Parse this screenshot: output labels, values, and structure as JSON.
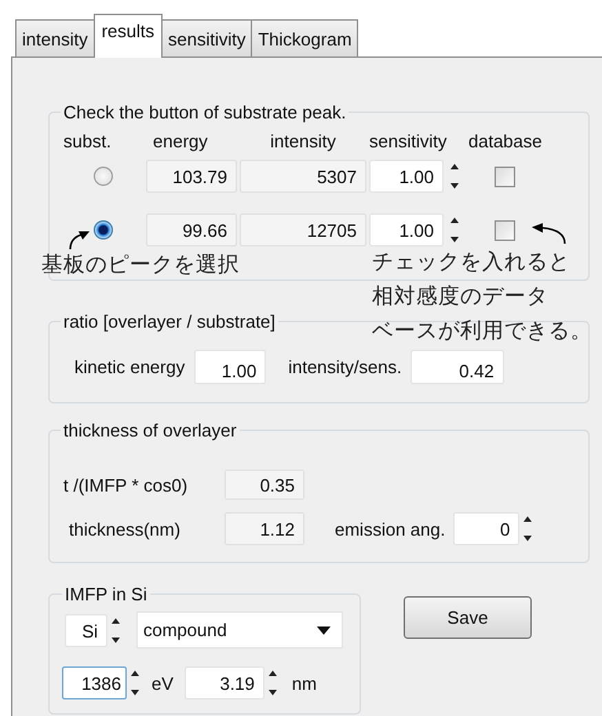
{
  "tabs": [
    {
      "label": "intensity",
      "selected": false
    },
    {
      "label": "results",
      "selected": true
    },
    {
      "label": "sensitivity",
      "selected": false
    },
    {
      "label": "Thickogram",
      "selected": false
    }
  ],
  "peak_group": {
    "legend": "Check the button of substrate peak.",
    "columns": [
      "subst.",
      "energy",
      "intensity",
      "sensitivity",
      "database"
    ],
    "rows": [
      {
        "selected": false,
        "energy": "103.79",
        "intensity": "5307",
        "sensitivity": "1.00",
        "database_checked": false
      },
      {
        "selected": true,
        "energy": "99.66",
        "intensity": "12705",
        "sensitivity": "1.00",
        "database_checked": false
      }
    ]
  },
  "annotations": [
    {
      "lines": [
        "基板のピークを選択"
      ]
    },
    {
      "lines": [
        "チェックを入れると",
        "相対感度のデータ",
        "ベースが利用できる。"
      ]
    }
  ],
  "ratio_group": {
    "legend": "ratio [overlayer / substrate]",
    "kinetic_energy_label": "kinetic energy",
    "kinetic_energy": "1.00",
    "intensity_label": "intensity/sens.",
    "intensity_value": "0.42"
  },
  "thickness_group": {
    "legend": "thickness of overlayer",
    "t_label": "t /(IMFP * cos0)",
    "t_value": "0.35",
    "thickness_label": "thickness(nm)",
    "thickness_value": "1.12",
    "emission_label": "emission ang.",
    "emission_value": "0"
  },
  "imfp_group": {
    "legend": "IMFP in Si",
    "element": "Si",
    "material": "compound",
    "energy": "1386",
    "energy_unit": "eV",
    "imfp": "3.19",
    "imfp_unit": "nm"
  },
  "save_button": "Save"
}
